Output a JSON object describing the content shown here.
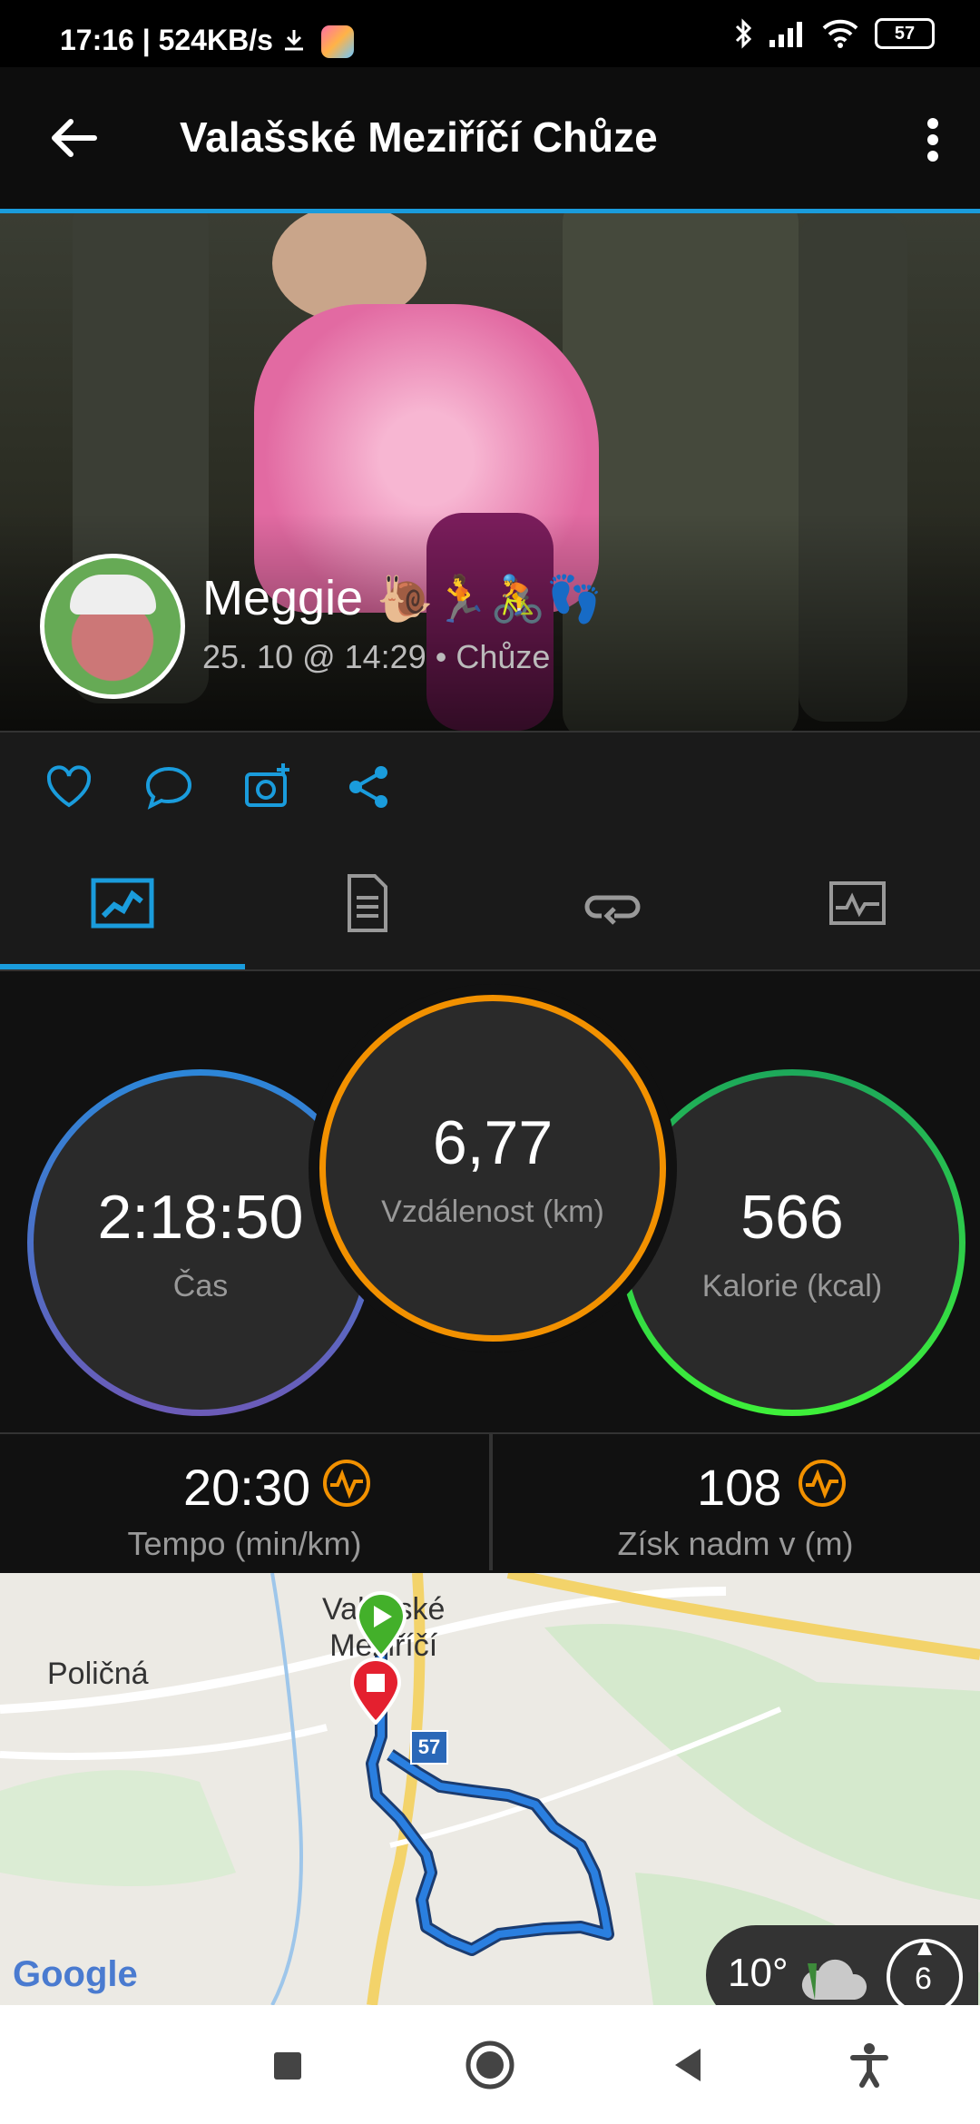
{
  "status_bar": {
    "time": "17:16 | 524KB/s",
    "battery": "57"
  },
  "appbar": {
    "title": "Valašské Meziříčí Chůze"
  },
  "activity": {
    "user_name": "Meggie",
    "user_emojis": "🐌🏃🚴👣",
    "date_type": "25. 10 @ 14:29 • Chůze"
  },
  "stats": {
    "time_value": "2:18:50",
    "time_label": "Čas",
    "distance_value": "6,77",
    "distance_label": "Vzdálenost (km)",
    "calories_value": "566",
    "calories_label": "Kalorie (kcal)"
  },
  "metrics": {
    "pace_value": "20:30",
    "pace_label": "Tempo (min/km)",
    "elev_value": "108",
    "elev_label": "Získ nadm v (m)"
  },
  "map": {
    "town_label_1": "Valašské",
    "town_label_2": "Meziříčí",
    "village_label": "Poličná",
    "road_number": "57",
    "google_label": "Google",
    "weather_temp": "10°",
    "wind_value": "6"
  },
  "colors": {
    "accent": "#1a9cdc",
    "orange": "#f29100",
    "green": "#25c94a",
    "purple": "#6c5bb8",
    "route": "#2a7fe0"
  }
}
